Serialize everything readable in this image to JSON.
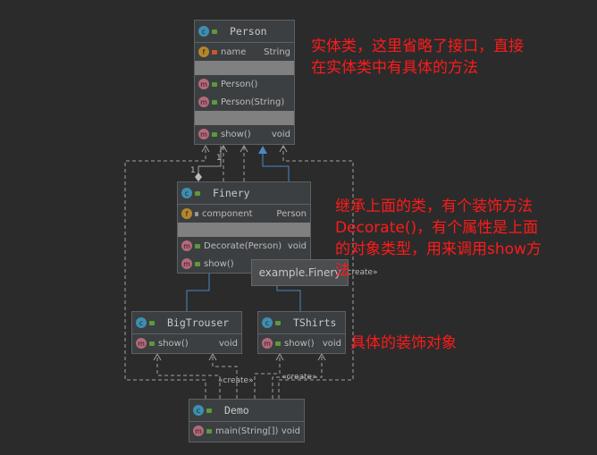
{
  "classes": {
    "person": {
      "name": "Person",
      "fields": [
        {
          "name": "name",
          "type": "String"
        }
      ],
      "methods": [
        {
          "name": "Person()",
          "type": ""
        },
        {
          "name": "Person(String)",
          "type": ""
        },
        {
          "name": "show()",
          "type": "void"
        }
      ]
    },
    "finery": {
      "name": "Finery",
      "fields": [
        {
          "name": "component",
          "type": "Person"
        }
      ],
      "methods": [
        {
          "name": "Decorate(Person)",
          "type": "void"
        },
        {
          "name": "show()",
          "type": ""
        }
      ]
    },
    "bigtrouser": {
      "name": "BigTrouser",
      "methods": [
        {
          "name": "show()",
          "type": "void"
        }
      ]
    },
    "tshirts": {
      "name": "TShirts",
      "methods": [
        {
          "name": "show()",
          "type": "void"
        }
      ]
    },
    "demo": {
      "name": "Demo",
      "methods": [
        {
          "name": "main(String[])",
          "type": "void"
        }
      ]
    }
  },
  "tooltip": "example.Finery",
  "labels": {
    "create1": "«create»",
    "create2": "«create»",
    "create3": "«create»",
    "mult1": "1",
    "mult2": "1"
  },
  "notes": {
    "person": "实体类，这里省略了接口，直接\n在实体类中有具体的方法",
    "finery": "继承上面的类，有个装饰方法\nDecorate()，有个属性是上面\n的对象类型，用来调用show方\n法",
    "concrete": "具体的装饰对象"
  },
  "colors": {
    "note": "#ff1a1a",
    "inherit": "#4a88c7",
    "background": "#2b2b2b"
  }
}
